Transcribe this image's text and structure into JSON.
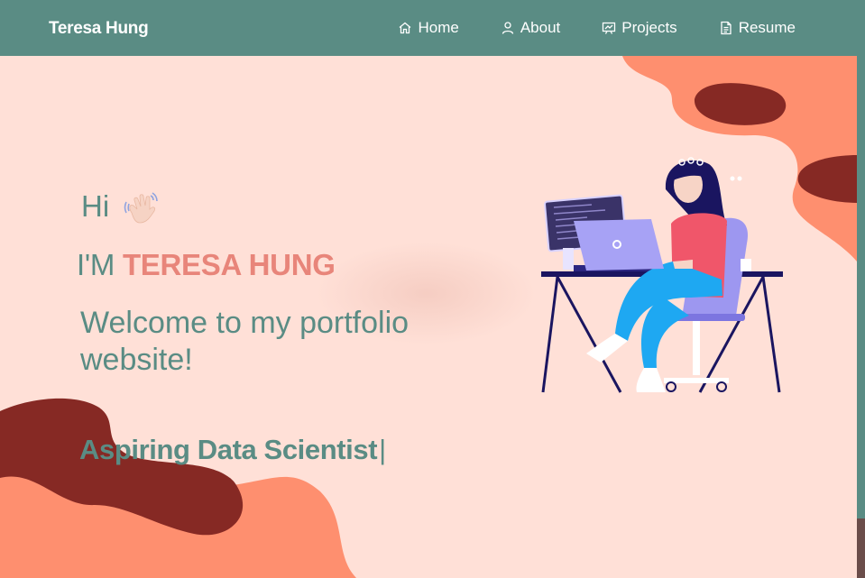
{
  "navbar": {
    "brand": "Teresa Hung",
    "links": [
      {
        "label": "Home",
        "icon": "home-icon"
      },
      {
        "label": "About",
        "icon": "user-icon"
      },
      {
        "label": "Projects",
        "icon": "presentation-icon"
      },
      {
        "label": "Resume",
        "icon": "document-icon"
      }
    ]
  },
  "hero": {
    "greeting": "Hi",
    "greeting_icon": "waving-hand-icon",
    "im_prefix": "I'M",
    "name": "TERESA HUNG",
    "welcome": "Welcome to my portfolio website!",
    "typed_text": "Aspiring Data Scientist",
    "cursor": "|"
  },
  "colors": {
    "navbar": "#5a8c84",
    "background": "#ffe0d7",
    "accent_name": "#e8857a",
    "text_teal": "#5a8c84",
    "blob_light": "#fe8f6f",
    "blob_dark": "#862924"
  }
}
